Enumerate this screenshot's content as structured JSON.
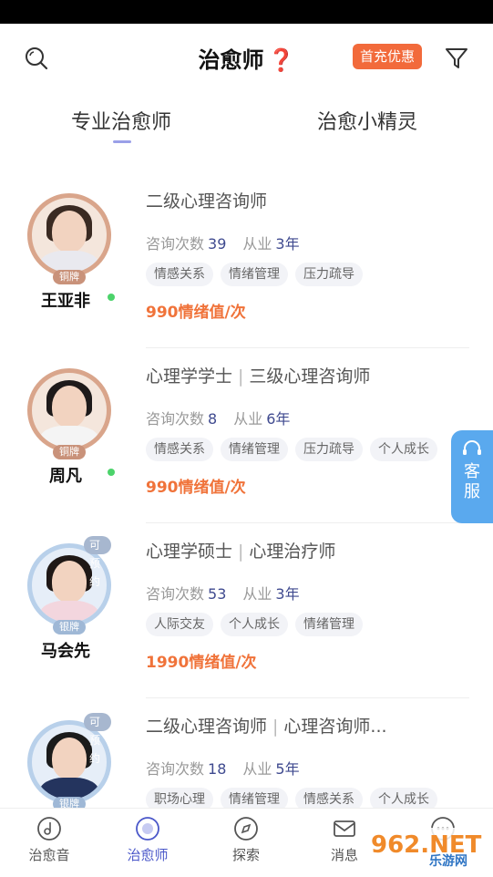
{
  "header": {
    "title": "治愈师",
    "help_icon": "❓",
    "promo_label": "首充优惠"
  },
  "tabs": [
    {
      "label": "专业治愈师",
      "active": true
    },
    {
      "label": "治愈小精灵",
      "active": false
    }
  ],
  "counsellors": [
    {
      "name": "王亚非",
      "title": "二级心理咨询师",
      "title_extra": "",
      "consult_label": "咨询次数",
      "consult_count": "39",
      "years_label": "从业",
      "years": "3年",
      "tags": [
        "情感关系",
        "情绪管理",
        "压力疏导"
      ],
      "price": "990情绪值/次",
      "medal": "铜牌",
      "medal_tier": "bronze",
      "online": true,
      "bookable": ""
    },
    {
      "name": "周凡",
      "title": "心理学学士",
      "title_extra": "三级心理咨询师",
      "consult_label": "咨询次数",
      "consult_count": "8",
      "years_label": "从业",
      "years": "6年",
      "tags": [
        "情感关系",
        "情绪管理",
        "压力疏导",
        "个人成长"
      ],
      "price": "990情绪值/次",
      "medal": "铜牌",
      "medal_tier": "bronze",
      "online": true,
      "bookable": ""
    },
    {
      "name": "马会先",
      "title": "心理学硕士",
      "title_extra": "心理治疗师",
      "consult_label": "咨询次数",
      "consult_count": "53",
      "years_label": "从业",
      "years": "3年",
      "tags": [
        "人际交友",
        "个人成长",
        "情绪管理"
      ],
      "price": "1990情绪值/次",
      "medal": "银牌",
      "medal_tier": "silver",
      "online": false,
      "bookable": "可预约"
    },
    {
      "name": "",
      "title": "二级心理咨询师",
      "title_extra": "心理咨询师...",
      "consult_label": "咨询次数",
      "consult_count": "18",
      "years_label": "从业",
      "years": "5年",
      "tags": [
        "职场心理",
        "情绪管理",
        "情感关系",
        "个人成长"
      ],
      "price": "",
      "medal": "银牌",
      "medal_tier": "silver",
      "online": false,
      "bookable": "可预约"
    }
  ],
  "service_button": {
    "line1": "客",
    "line2": "服"
  },
  "bottom_nav": [
    {
      "label": "治愈音",
      "icon": "music-note-icon",
      "active": false
    },
    {
      "label": "治愈师",
      "icon": "counsellor-icon",
      "active": true
    },
    {
      "label": "探索",
      "icon": "explore-icon",
      "active": false
    },
    {
      "label": "消息",
      "icon": "mail-icon",
      "active": false
    },
    {
      "label": "",
      "icon": "chat-icon",
      "active": false
    }
  ],
  "watermark": {
    "main": "962.NET",
    "sub": "乐游网"
  },
  "colors": {
    "accent": "#4a57c9",
    "price": "#f0733a",
    "promo": "#f26a3b",
    "service": "#5aa9ee",
    "online": "#4cd36b"
  }
}
